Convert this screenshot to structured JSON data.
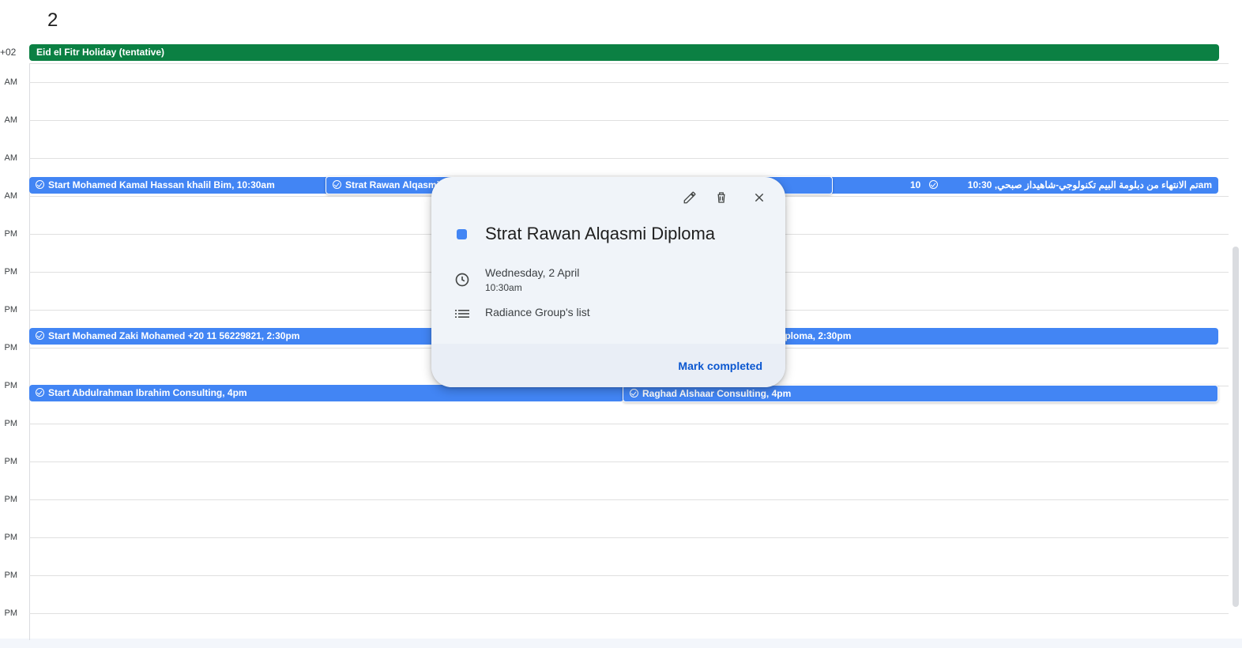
{
  "header": {
    "day_number": "2",
    "timezone": "+02"
  },
  "all_day_event": {
    "title": "Eid el Fitr Holiday (tentative)",
    "color": "#0b8043"
  },
  "hours": [
    "AM",
    "AM",
    "AM",
    "AM",
    "PM",
    "PM",
    "PM",
    "PM",
    "PM",
    "PM",
    "PM",
    "PM",
    "PM",
    "PM",
    "PM"
  ],
  "events": {
    "row1": {
      "kamal": "Start Mohamed Kamal Hassan khalil Bim, 10:30am",
      "rawan_partial": "Strat Rawan Alqasmi",
      "hidden_partial": "10",
      "arabic": "تم الانتهاء من دبلومة البيم تكنولوجي-شاهيداز صبحي, 10:30am"
    },
    "row2": {
      "zaki": "Start Mohamed Zaki Mohamed +20 11 56229821, 2:30pm",
      "diploma_partial": "iploma, 2:30pm"
    },
    "row3": {
      "abdulrahman": "Start Abdulrahman Ibrahim Consulting, 4pm",
      "raghad": "Raghad Alshaar Consulting, 4pm"
    },
    "color": "#4285f4"
  },
  "popup": {
    "title": "Strat Rawan Alqasmi Diploma",
    "date": "Wednesday, 2 April",
    "time": "10:30am",
    "list": "Radiance Group's list",
    "mark_completed": "Mark completed",
    "icons": [
      "edit-icon",
      "delete-icon",
      "close-icon",
      "clock-icon",
      "list-icon"
    ]
  }
}
